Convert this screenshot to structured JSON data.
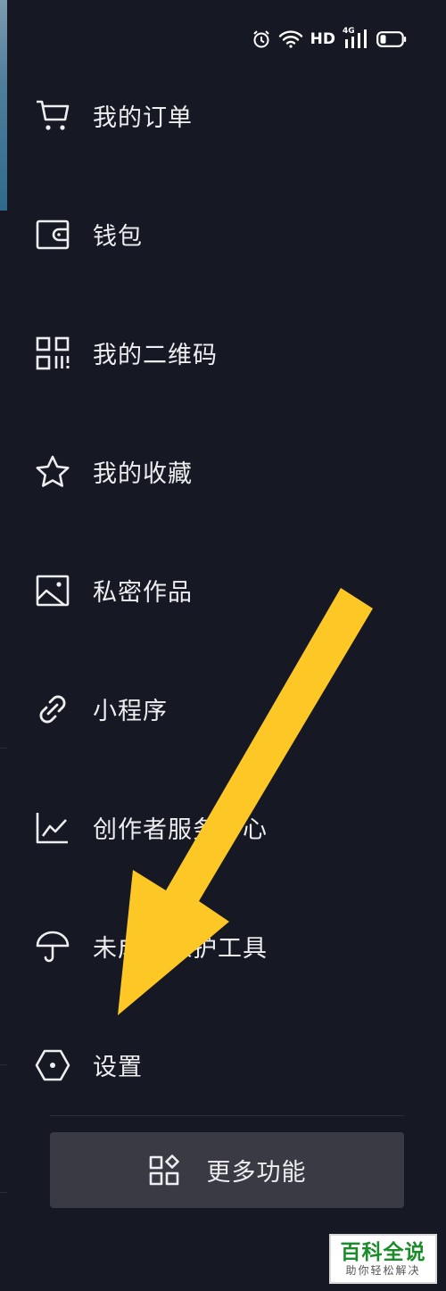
{
  "status_bar": {
    "network_label": "HD",
    "signal_label": "4G",
    "icons": [
      "alarm-icon",
      "wifi-icon",
      "signal-icon",
      "battery-icon"
    ]
  },
  "menu": {
    "items": [
      {
        "label": "我的订单",
        "icon": "cart-icon"
      },
      {
        "label": "钱包",
        "icon": "wallet-icon"
      },
      {
        "label": "我的二维码",
        "icon": "qr-code-icon"
      },
      {
        "label": "我的收藏",
        "icon": "star-icon"
      },
      {
        "label": "私密作品",
        "icon": "image-icon"
      },
      {
        "label": "小程序",
        "icon": "link-icon"
      },
      {
        "label": "创作者服务中心",
        "icon": "chart-icon"
      },
      {
        "label": "未成年保护工具",
        "icon": "umbrella-icon"
      },
      {
        "label": "设置",
        "icon": "hexagon-settings-icon"
      }
    ]
  },
  "more_button": {
    "label": "更多功能",
    "icon": "grid-icon"
  },
  "watermark": {
    "title": "百科全说",
    "subtitle": "助你轻松解决"
  },
  "colors": {
    "background": "#161823",
    "text": "#eeeef0",
    "button_bg": "#393a44",
    "arrow": "#fdc826",
    "watermark_green": "#1a8c2a"
  }
}
